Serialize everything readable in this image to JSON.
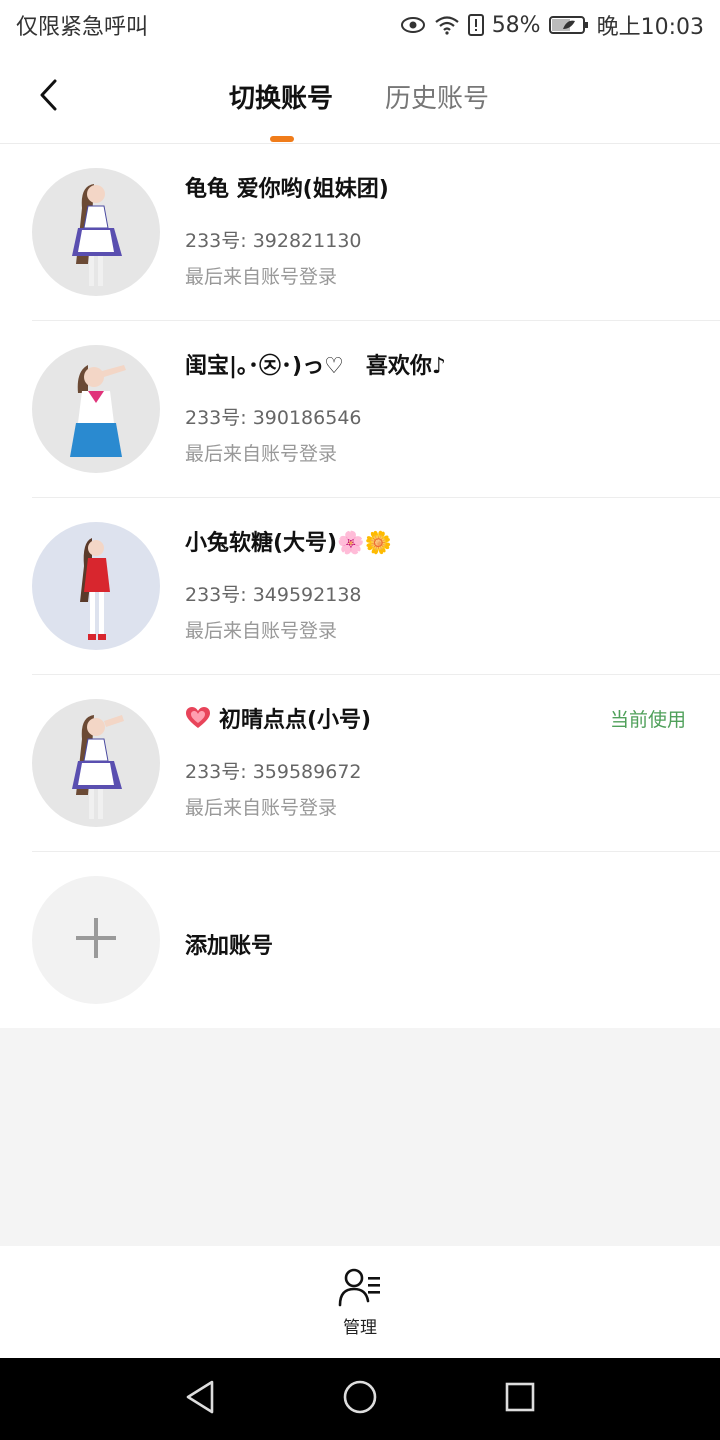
{
  "status_bar": {
    "carrier": "仅限紧急呼叫",
    "battery": "58%",
    "time": "晚上10:03"
  },
  "header": {
    "tab_switch": "切换账号",
    "tab_history": "历史账号",
    "accent_color": "#f07c1a"
  },
  "accounts": [
    {
      "name": "龟龟 爱你哟(姐妹团)",
      "uid": "233号: 392821130",
      "login": "最后来自账号登录",
      "badge": ""
    },
    {
      "name": "闺宝|｡･㉨･)っ♡　喜欢你♪",
      "uid": "233号: 390186546",
      "login": "最后来自账号登录",
      "badge": ""
    },
    {
      "name": "小兔软糖(大号)🌸🌼",
      "uid": "233号: 349592138",
      "login": "最后来自账号登录",
      "badge": ""
    },
    {
      "name": "初晴点点(小号)",
      "uid": "233号: 359589672",
      "login": "最后来自账号登录",
      "badge": "当前使用"
    }
  ],
  "add_account": {
    "label": "添加账号"
  },
  "bottom_bar": {
    "manage_label": "管理"
  },
  "icons": {
    "back": "chevron-left-icon",
    "add": "plus-icon",
    "manage": "user-list-icon",
    "heart": "heart-icon"
  },
  "colors": {
    "current_badge": "#4fa05a"
  }
}
